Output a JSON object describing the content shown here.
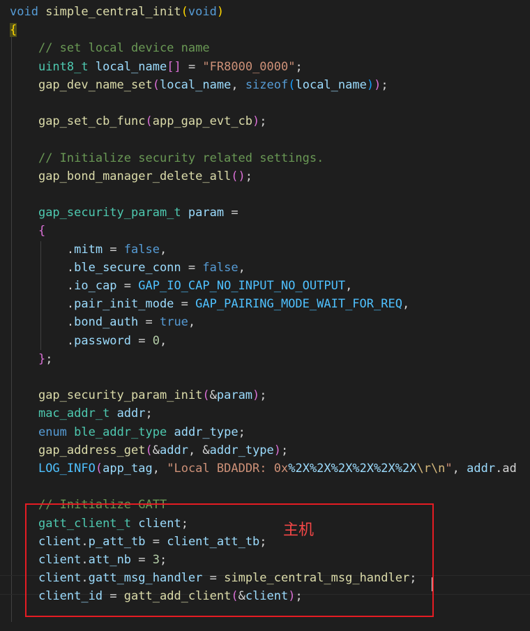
{
  "annotation": {
    "label": "主机"
  },
  "lines": [
    {
      "segments": [
        {
          "text": "void",
          "cls": "k"
        },
        {
          "text": " "
        },
        {
          "text": "simple_central_init",
          "cls": "f"
        },
        {
          "text": "(",
          "cls": "p1"
        },
        {
          "text": "void",
          "cls": "k"
        },
        {
          "text": ")",
          "cls": "p1"
        }
      ]
    },
    {
      "segments": [
        {
          "text": "{",
          "cls": "p1 brace-hl"
        }
      ]
    },
    {
      "segments": [
        {
          "text": "    "
        },
        {
          "text": "// set local device name",
          "cls": "c"
        }
      ]
    },
    {
      "segments": [
        {
          "text": "    "
        },
        {
          "text": "uint8_t",
          "cls": "t"
        },
        {
          "text": " "
        },
        {
          "text": "local_name",
          "cls": "v"
        },
        {
          "text": "[]",
          "cls": "p2"
        },
        {
          "text": " = "
        },
        {
          "text": "\"FR8000_0000\"",
          "cls": "s"
        },
        {
          "text": ";"
        }
      ]
    },
    {
      "segments": [
        {
          "text": "    "
        },
        {
          "text": "gap_dev_name_set",
          "cls": "f"
        },
        {
          "text": "(",
          "cls": "p2"
        },
        {
          "text": "local_name",
          "cls": "v"
        },
        {
          "text": ", "
        },
        {
          "text": "sizeof",
          "cls": "k"
        },
        {
          "text": "(",
          "cls": "p3"
        },
        {
          "text": "local_name",
          "cls": "v"
        },
        {
          "text": ")",
          "cls": "p3"
        },
        {
          "text": ")",
          "cls": "p2"
        },
        {
          "text": ";"
        }
      ]
    },
    {
      "segments": []
    },
    {
      "segments": [
        {
          "text": "    "
        },
        {
          "text": "gap_set_cb_func",
          "cls": "f"
        },
        {
          "text": "(",
          "cls": "p2"
        },
        {
          "text": "app_gap_evt_cb",
          "cls": "f"
        },
        {
          "text": ")",
          "cls": "p2"
        },
        {
          "text": ";"
        }
      ]
    },
    {
      "segments": []
    },
    {
      "segments": [
        {
          "text": "    "
        },
        {
          "text": "// Initialize security related settings.",
          "cls": "c"
        }
      ]
    },
    {
      "segments": [
        {
          "text": "    "
        },
        {
          "text": "gap_bond_manager_delete_all",
          "cls": "f"
        },
        {
          "text": "()",
          "cls": "p2"
        },
        {
          "text": ";"
        }
      ]
    },
    {
      "segments": []
    },
    {
      "segments": [
        {
          "text": "    "
        },
        {
          "text": "gap_security_param_t",
          "cls": "t"
        },
        {
          "text": " "
        },
        {
          "text": "param",
          "cls": "v"
        },
        {
          "text": " ="
        }
      ]
    },
    {
      "segments": [
        {
          "text": "    "
        },
        {
          "text": "{",
          "cls": "p2"
        }
      ]
    },
    {
      "segments": [
        {
          "text": "        ."
        },
        {
          "text": "mitm",
          "cls": "v"
        },
        {
          "text": " = "
        },
        {
          "text": "false",
          "cls": "k"
        },
        {
          "text": ","
        }
      ]
    },
    {
      "segments": [
        {
          "text": "        ."
        },
        {
          "text": "ble_secure_conn",
          "cls": "v"
        },
        {
          "text": " = "
        },
        {
          "text": "false",
          "cls": "k"
        },
        {
          "text": ","
        }
      ]
    },
    {
      "segments": [
        {
          "text": "        ."
        },
        {
          "text": "io_cap",
          "cls": "v"
        },
        {
          "text": " = "
        },
        {
          "text": "GAP_IO_CAP_NO_INPUT_NO_OUTPUT",
          "cls": "m"
        },
        {
          "text": ","
        }
      ]
    },
    {
      "segments": [
        {
          "text": "        ."
        },
        {
          "text": "pair_init_mode",
          "cls": "v"
        },
        {
          "text": " = "
        },
        {
          "text": "GAP_PAIRING_MODE_WAIT_FOR_REQ",
          "cls": "m"
        },
        {
          "text": ","
        }
      ]
    },
    {
      "segments": [
        {
          "text": "        ."
        },
        {
          "text": "bond_auth",
          "cls": "v"
        },
        {
          "text": " = "
        },
        {
          "text": "true",
          "cls": "k"
        },
        {
          "text": ","
        }
      ]
    },
    {
      "segments": [
        {
          "text": "        ."
        },
        {
          "text": "password",
          "cls": "v"
        },
        {
          "text": " = "
        },
        {
          "text": "0",
          "cls": "n"
        },
        {
          "text": ","
        }
      ]
    },
    {
      "segments": [
        {
          "text": "    "
        },
        {
          "text": "}",
          "cls": "p2"
        },
        {
          "text": ";"
        }
      ]
    },
    {
      "segments": []
    },
    {
      "segments": [
        {
          "text": "    "
        },
        {
          "text": "gap_security_param_init",
          "cls": "f"
        },
        {
          "text": "(",
          "cls": "p2"
        },
        {
          "text": "&"
        },
        {
          "text": "param",
          "cls": "v"
        },
        {
          "text": ")",
          "cls": "p2"
        },
        {
          "text": ";"
        }
      ]
    },
    {
      "segments": [
        {
          "text": "    "
        },
        {
          "text": "mac_addr_t",
          "cls": "t"
        },
        {
          "text": " "
        },
        {
          "text": "addr",
          "cls": "v"
        },
        {
          "text": ";"
        }
      ]
    },
    {
      "segments": [
        {
          "text": "    "
        },
        {
          "text": "enum",
          "cls": "k"
        },
        {
          "text": " "
        },
        {
          "text": "ble_addr_type",
          "cls": "t"
        },
        {
          "text": " "
        },
        {
          "text": "addr_type",
          "cls": "v"
        },
        {
          "text": ";"
        }
      ]
    },
    {
      "segments": [
        {
          "text": "    "
        },
        {
          "text": "gap_address_get",
          "cls": "f"
        },
        {
          "text": "(",
          "cls": "p2"
        },
        {
          "text": "&"
        },
        {
          "text": "addr",
          "cls": "v"
        },
        {
          "text": ", &"
        },
        {
          "text": "addr_type",
          "cls": "v"
        },
        {
          "text": ")",
          "cls": "p2"
        },
        {
          "text": ";"
        }
      ]
    },
    {
      "segments": [
        {
          "text": "    "
        },
        {
          "text": "LOG_INFO",
          "cls": "m"
        },
        {
          "text": "(",
          "cls": "p2"
        },
        {
          "text": "app_tag",
          "cls": "v"
        },
        {
          "text": ", "
        },
        {
          "text": "\"Local BDADDR: 0x",
          "cls": "s"
        },
        {
          "text": "%2X%2X%2X%2X%2X%2X",
          "cls": "v"
        },
        {
          "text": "\\r\\n",
          "cls": "e"
        },
        {
          "text": "\"",
          "cls": "s"
        },
        {
          "text": ", "
        },
        {
          "text": "addr",
          "cls": "v"
        },
        {
          "text": ".ad"
        }
      ]
    },
    {
      "segments": []
    },
    {
      "segments": [
        {
          "text": "    "
        },
        {
          "text": "// Initialize GATT",
          "cls": "c"
        }
      ]
    },
    {
      "segments": [
        {
          "text": "    "
        },
        {
          "text": "gatt_client_t",
          "cls": "t"
        },
        {
          "text": " "
        },
        {
          "text": "client",
          "cls": "v"
        },
        {
          "text": ";"
        }
      ]
    },
    {
      "segments": [
        {
          "text": "    "
        },
        {
          "text": "client",
          "cls": "v"
        },
        {
          "text": "."
        },
        {
          "text": "p_att_tb",
          "cls": "v"
        },
        {
          "text": " = "
        },
        {
          "text": "client_att_tb",
          "cls": "v"
        },
        {
          "text": ";"
        }
      ]
    },
    {
      "segments": [
        {
          "text": "    "
        },
        {
          "text": "client",
          "cls": "v"
        },
        {
          "text": "."
        },
        {
          "text": "att_nb",
          "cls": "v"
        },
        {
          "text": " = "
        },
        {
          "text": "3",
          "cls": "n"
        },
        {
          "text": ";"
        }
      ]
    },
    {
      "segments": [
        {
          "text": "    "
        },
        {
          "text": "client",
          "cls": "v"
        },
        {
          "text": "."
        },
        {
          "text": "gatt_msg_handler",
          "cls": "v"
        },
        {
          "text": " = "
        },
        {
          "text": "simple_central_msg_handler",
          "cls": "f"
        },
        {
          "text": ";"
        }
      ]
    },
    {
      "segments": [
        {
          "text": "    "
        },
        {
          "text": "client_id",
          "cls": "v"
        },
        {
          "text": " = "
        },
        {
          "text": "gatt_add_client",
          "cls": "f"
        },
        {
          "text": "(",
          "cls": "p2"
        },
        {
          "text": "&"
        },
        {
          "text": "client",
          "cls": "v"
        },
        {
          "text": ")",
          "cls": "p2"
        },
        {
          "text": ";"
        }
      ]
    }
  ]
}
